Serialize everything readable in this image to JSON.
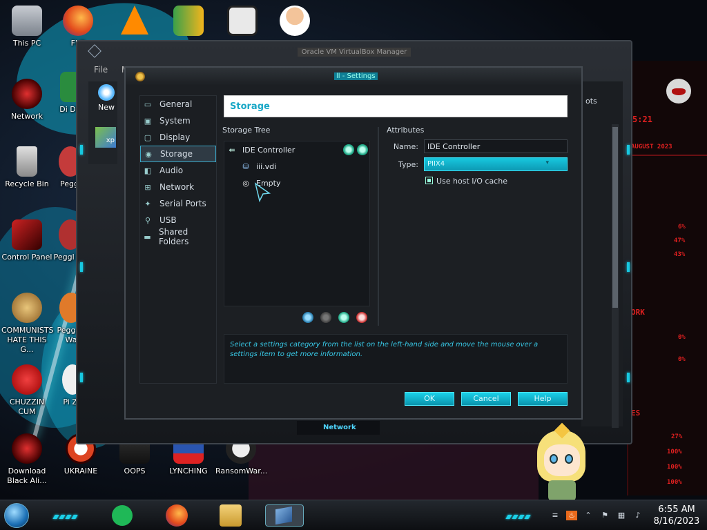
{
  "desktop": {
    "icons": [
      {
        "label": "This PC"
      },
      {
        "label": "FUF"
      },
      {
        "label": "Network"
      },
      {
        "label": "Di DU"
      },
      {
        "label": "Recycle Bin"
      },
      {
        "label": "Peggl"
      },
      {
        "label": "Control Panel"
      },
      {
        "label": "Peggl De"
      },
      {
        "label": "COMMUNISTS HATE THIS G..."
      },
      {
        "label": "Pegg of Wa"
      },
      {
        "label": "CHUZZIN CUM"
      },
      {
        "label": "Pi Zo"
      },
      {
        "label": "Download Black Ali..."
      },
      {
        "label": "UKRAINE"
      },
      {
        "label": "OOPS"
      },
      {
        "label": "LYNCHING"
      },
      {
        "label": "RansomWar..."
      }
    ]
  },
  "widget": {
    "time_fragment": "5:21",
    "date_fragment": "AUGUST 2023",
    "stat1": "6%",
    "stat2": "47%",
    "stat3": "43%",
    "net_label": "ORK",
    "stat4": "0%",
    "stat5": "0%",
    "disk_label": "ES",
    "stat6": "27%",
    "stat7": "100%",
    "stat8": "100%",
    "stat9": "100%"
  },
  "manager": {
    "title": "Oracle VM VirtualBox Manager",
    "menu_file": "File",
    "menu_m": "M",
    "new_label": "New",
    "xp_label": "xp",
    "snapshots_fragment": "ots",
    "bottom_tab": "Network"
  },
  "settings": {
    "title": "ll - Settings",
    "nav": [
      {
        "label": "General",
        "icon": "monitor-icon"
      },
      {
        "label": "System",
        "icon": "chip-icon"
      },
      {
        "label": "Display",
        "icon": "display-icon"
      },
      {
        "label": "Storage",
        "icon": "disk-icon"
      },
      {
        "label": "Audio",
        "icon": "speaker-icon"
      },
      {
        "label": "Network",
        "icon": "network-icon"
      },
      {
        "label": "Serial Ports",
        "icon": "serial-icon"
      },
      {
        "label": "USB",
        "icon": "usb-icon"
      },
      {
        "label": "Shared Folders",
        "icon": "folder-icon"
      }
    ],
    "active_nav": "Storage",
    "page_header": "Storage",
    "storage_tree_label": "Storage Tree",
    "tree": {
      "controller": "IDE Controller",
      "items": [
        {
          "label": "iii.vdi",
          "icon": "hard-disk-icon"
        },
        {
          "label": "Empty",
          "icon": "optical-disc-icon"
        }
      ]
    },
    "attributes_label": "Attributes",
    "name_label": "Name:",
    "name_value": "IDE Controller",
    "type_label": "Type:",
    "type_value": "PIIX4",
    "use_host_io_cache_label": "Use host I/O cache",
    "use_host_io_cache_checked": true,
    "info_text": "Select a settings category from the list on the left-hand side and move the mouse over a settings item to get more information.",
    "ok_label": "OK",
    "cancel_label": "Cancel",
    "help_label": "Help"
  },
  "taskbar": {
    "time": "6:55 AM",
    "date": "8/16/2023"
  },
  "colors": {
    "accent": "#18c8df",
    "accent_dark": "#0a94ad",
    "widget_red": "#e02020"
  }
}
